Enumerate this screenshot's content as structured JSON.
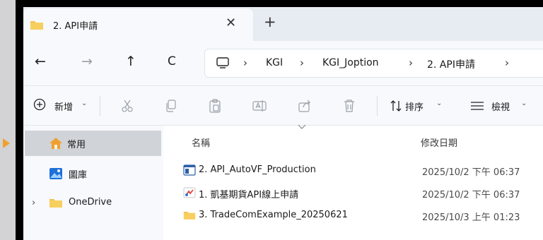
{
  "tab": {
    "title": "2. API申請",
    "close_glyph": "✕",
    "new_tab_glyph": "+"
  },
  "nav": {
    "back_glyph": "←",
    "forward_glyph": "→",
    "up_glyph": "↑",
    "refresh_glyph": "C",
    "breadcrumbs": [
      "KGI",
      "KGI_Joption",
      "2. API申請"
    ],
    "separator": "›"
  },
  "toolbar": {
    "new_label": "新增",
    "sort_label": "排序",
    "view_label": "檢視",
    "chevron": "⌄"
  },
  "sidebar": {
    "items": [
      {
        "label": "常用",
        "icon": "home-icon",
        "selected": true
      },
      {
        "label": "圖庫",
        "icon": "gallery-icon"
      },
      {
        "label": "OneDrive",
        "icon": "folder-icon",
        "expand": "›"
      }
    ]
  },
  "filelist": {
    "headers": {
      "name": "名稱",
      "date": "修改日期"
    },
    "rows": [
      {
        "name": "2. API_AutoVF_Production",
        "date": "2025/10/2 下午 06:37",
        "icon": "application-icon"
      },
      {
        "name": "1. 凱基期貨API線上申請",
        "date": "2025/10/2 下午 06:37",
        "icon": "web-shortcut-icon"
      },
      {
        "name": "3. TradeComExample_20250621",
        "date": "2025/10/3 上午 01:23",
        "icon": "folder-icon"
      }
    ]
  },
  "colors": {
    "accent": "#f0a030",
    "folder": "#f2c14e",
    "selection": "#d0d3d8"
  }
}
